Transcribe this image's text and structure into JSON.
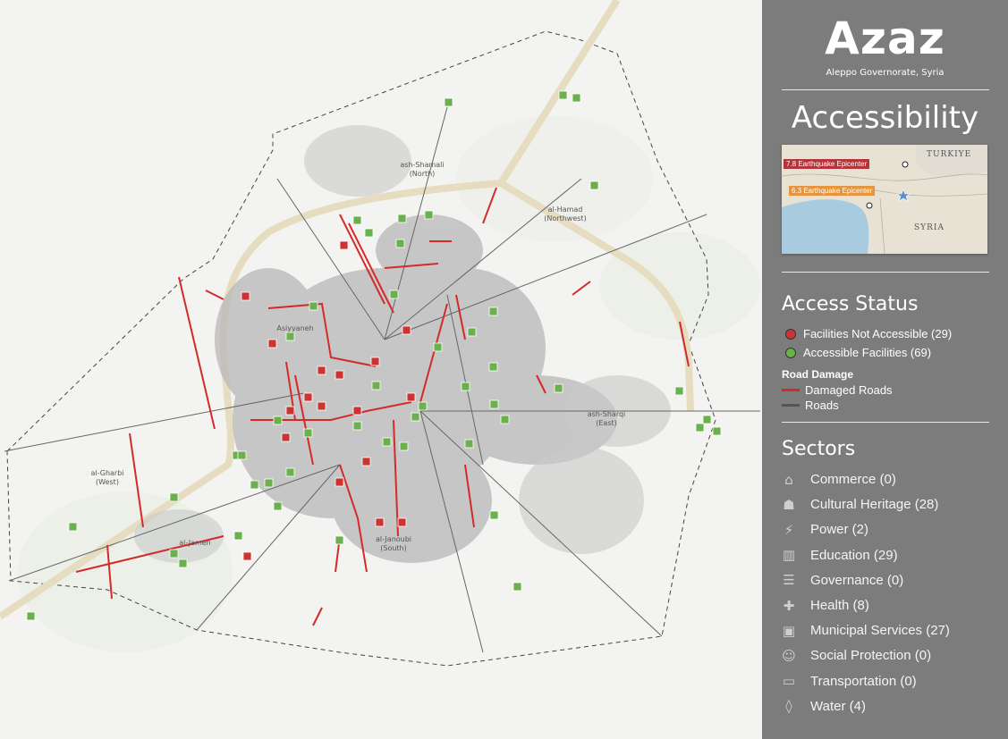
{
  "header": {
    "city": "Azaz",
    "subtitle": "Aleppo Governorate, Syria",
    "theme": "Accessibility"
  },
  "inset": {
    "labels": {
      "epicenter_78": "7.8 Earthquake Epicenter",
      "epicenter_63": "6.3 Earthquake Epicenter",
      "turkiye": "TURKIYE",
      "syria": "SYRIA"
    },
    "colors": {
      "epicenter_78": "#b5343a",
      "epicenter_63": "#e5953c"
    }
  },
  "legend": {
    "title": "Access Status",
    "status": [
      {
        "label": "Facilities Not Accessible (29)",
        "color": "#cc3333"
      },
      {
        "label": "Accessible Facilities (69)",
        "color": "#6ab04c"
      }
    ],
    "road_title": "Road Damage",
    "roads": [
      {
        "label": "Damaged Roads",
        "color": "#d42a2a"
      },
      {
        "label": "Roads",
        "color": "#555555"
      }
    ]
  },
  "sectors": {
    "title": "Sectors",
    "items": [
      {
        "label": "Commerce (0)",
        "icon": "commerce-icon"
      },
      {
        "label": "Cultural Heritage (28)",
        "icon": "cultural-heritage-icon"
      },
      {
        "label": "Power (2)",
        "icon": "power-icon"
      },
      {
        "label": "Education (29)",
        "icon": "education-icon"
      },
      {
        "label": "Governance (0)",
        "icon": "governance-icon"
      },
      {
        "label": "Health (8)",
        "icon": "health-icon"
      },
      {
        "label": "Municipal Services (27)",
        "icon": "municipal-services-icon"
      },
      {
        "label": "Social Protection (0)",
        "icon": "social-protection-icon"
      },
      {
        "label": "Transportation (0)",
        "icon": "transportation-icon"
      },
      {
        "label": "Water (4)",
        "icon": "water-icon"
      }
    ]
  },
  "map": {
    "districts": {
      "north": [
        "ash-Shamali",
        "(North)"
      ],
      "northwest": [
        "al-Hamad",
        "(Northwest)"
      ],
      "east": [
        "ash-Sharqi",
        "(East)"
      ],
      "west": [
        "al-Gharbi",
        "(West)"
      ],
      "south": [
        "al-Janoubi",
        "(South)"
      ],
      "asiyyaneh": "Asiyyaneh",
      "jameh": "al-Jameh"
    }
  }
}
